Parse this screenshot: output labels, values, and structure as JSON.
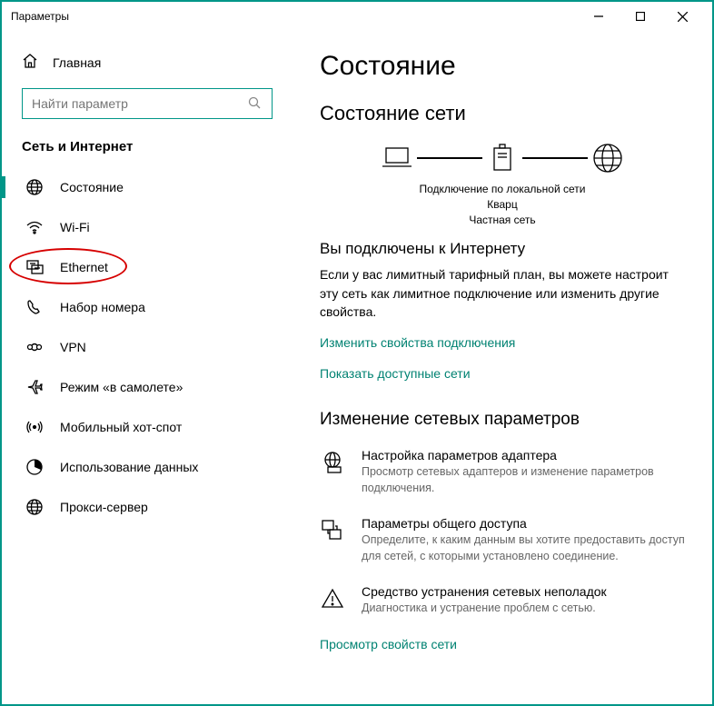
{
  "window": {
    "title": "Параметры"
  },
  "home": {
    "label": "Главная"
  },
  "search": {
    "placeholder": "Найти параметр"
  },
  "sectionHeader": "Сеть и Интернет",
  "nav": [
    {
      "label": "Состояние"
    },
    {
      "label": "Wi-Fi"
    },
    {
      "label": "Ethernet"
    },
    {
      "label": "Набор номера"
    },
    {
      "label": "VPN"
    },
    {
      "label": "Режим «в самолете»"
    },
    {
      "label": "Мобильный хот-спот"
    },
    {
      "label": "Использование данных"
    },
    {
      "label": "Прокси-сервер"
    }
  ],
  "page": {
    "title": "Состояние",
    "subtitle": "Состояние сети",
    "diagram": {
      "line1": "Подключение по локальной сети",
      "line2": "Кварц",
      "line3": "Частная сеть"
    },
    "connectedHeading": "Вы подключены к Интернету",
    "connectedDesc": "Если у вас лимитный тарифный план, вы можете настроит эту сеть как лимитное подключение или изменить другие свойства.",
    "link1": "Изменить свойства подключения",
    "link2": "Показать доступные сети",
    "changeTitle": "Изменение сетевых параметров",
    "options": [
      {
        "title": "Настройка параметров адаптера",
        "desc": "Просмотр сетевых адаптеров и изменение параметров подключения."
      },
      {
        "title": "Параметры общего доступа",
        "desc": "Определите, к каким данным вы хотите предоставить доступ для сетей, с которыми установлено соединение."
      },
      {
        "title": "Средство устранения сетевых неполадок",
        "desc": "Диагностика и устранение проблем с сетью."
      }
    ],
    "link3": "Просмотр свойств сети"
  }
}
